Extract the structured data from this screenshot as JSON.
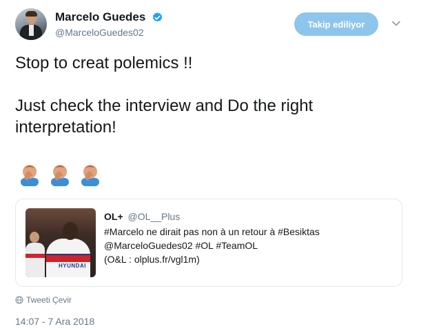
{
  "author": {
    "display_name": "Marcelo Guedes",
    "handle": "@MarceloGuedes02",
    "verified": true
  },
  "follow_button": {
    "label": "Takip ediliyor",
    "color": "#8ec5ec"
  },
  "tweet": {
    "text": "Stop to creat polemics !!\n\nJust check the interview and Do the right interpretation!",
    "emojis": [
      "facepalm-icon",
      "facepalm-icon",
      "facepalm-icon"
    ]
  },
  "quoted_tweet": {
    "display_name": "OL+",
    "handle": "@OL__Plus",
    "text": "#Marcelo ne dirait pas non à un retour à #Besiktas\n@MarceloGuedes02 #OL #TeamOL\n(O&L : olplus.fr/vgl1m)",
    "thumbnail_sponsor": "HYUNDAI"
  },
  "translate": {
    "label": "Tweeti Çevir"
  },
  "timestamp": "14:07 - 7 Ara 2018",
  "colors": {
    "accent": "#1da1f2",
    "muted": "#657786",
    "text": "#14171a"
  }
}
